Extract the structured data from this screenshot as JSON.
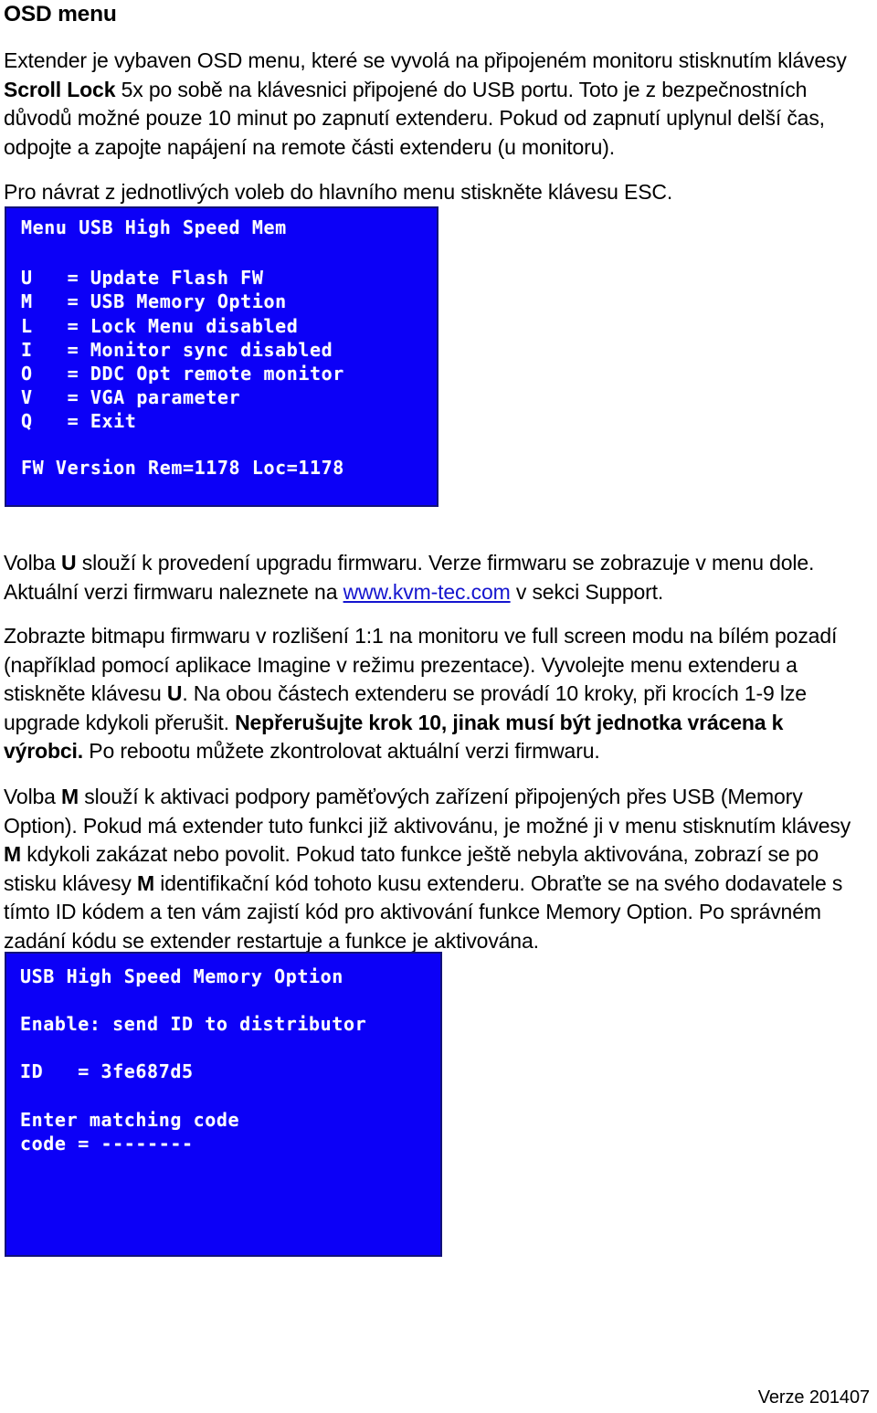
{
  "document": {
    "heading": "OSD menu",
    "footer_version": "Verze 201407",
    "link_color": "#1414cf",
    "osd_background_color": "#0c00f7",
    "osd_text_color": "#ffffff"
  },
  "paragraphs": {
    "intro": {
      "seg1": "Extender je vybaven OSD menu, které se vyvolá na připojeném monitoru stisknutím klávesy ",
      "bold1": "Scroll Lock",
      "seg2": " 5x po sobě na klávesnici připojené do USB portu. Toto je z bezpečnostních důvodů možné pouze 10 minut po zapnutí extenderu. Pokud od zapnutí uplynul delší čas, odpojte a zapojte napájení na remote části extenderu (u monitoru)."
    },
    "esc": "Pro návrat z jednotlivých voleb do hlavního menu stiskněte klávesu ESC.",
    "volba_u": {
      "seg1": "Volba ",
      "bold1": "U",
      "seg2": " slouží k provedení upgradu firmwaru. Verze firmwaru se zobrazuje v menu dole. Aktuální verzi firmwaru naleznete na ",
      "link": "www.kvm-tec.com",
      "seg3": " v sekci Support."
    },
    "bitmap": {
      "seg1": "Zobrazte bitmapu firmwaru v rozlišení 1:1 na monitoru ve full screen modu na bílém pozadí (například pomocí aplikace Imagine v režimu prezentace). Vyvolejte menu extenderu a stiskněte klávesu ",
      "bold1": "U",
      "seg2": ". Na obou částech extenderu se provádí 10 kroky, při krocích 1-9 lze upgrade kdykoli přerušit. ",
      "bold2": "Nepřerušujte krok 10, jinak musí být jednotka vrácena k výrobci.",
      "seg3": " Po rebootu můžete zkontrolovat aktuální verzi firmwaru."
    },
    "volba_m": {
      "seg1": "Volba ",
      "bold1": "M",
      "seg2": " slouží k aktivaci podpory paměťových zařízení připojených přes USB (Memory Option). Pokud má extender tuto funkci již aktivovánu, je možné ji v menu stisknutím klávesy ",
      "bold2": "M",
      "seg3": " kdykoli zakázat nebo povolit. Pokud tato funkce ještě nebyla aktivována, zobrazí se po stisku klávesy ",
      "bold3": "M",
      "seg4": " identifikační kód tohoto kusu extenderu. Obraťte se na svého dodavatele s tímto ID kódem a ten vám zajistí kód pro aktivování funkce Memory Option. Po správném zadání kódu se extender restartuje a funkce je aktivována."
    }
  },
  "osd_main_menu": {
    "title": "Menu USB High Speed Mem",
    "rows": [
      "U   = Update Flash FW",
      "M   = USB Memory Option",
      "L   = Lock Menu disabled",
      "I   = Monitor sync disabled",
      "O   = DDC Opt remote monitor",
      "V   = VGA parameter",
      "Q   = Exit"
    ],
    "firmware_version_line": "FW Version Rem=1178 Loc=1178"
  },
  "osd_memory_option": {
    "title": "USB High Speed Memory Option",
    "enable_line": "Enable: send ID to distributor",
    "id_line": "ID   = 3fe687d5",
    "enter_line": "Enter matching code",
    "code_line": "code = --------"
  }
}
